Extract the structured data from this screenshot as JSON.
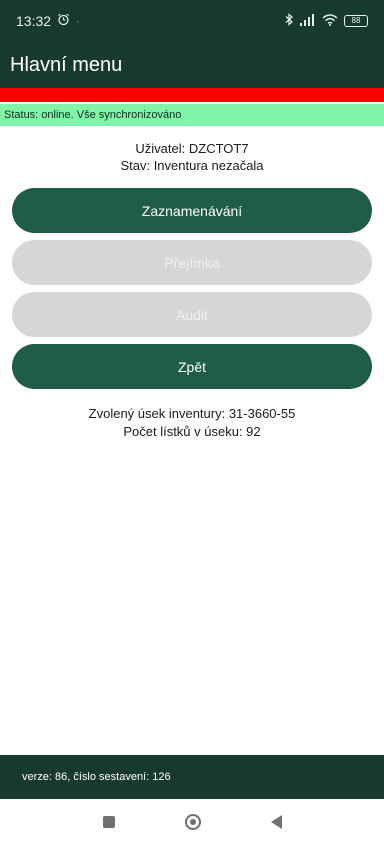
{
  "status_bar": {
    "time": "13:32",
    "alarm_icon": "alarm-clock-icon",
    "notification_dot": "·",
    "battery": "88"
  },
  "app_bar": {
    "title": "Hlavní menu"
  },
  "sync_status": "Status: online. Vše synchronizováno",
  "user_info": {
    "user": "Uživatel: DZCTOT7",
    "state": "Stav: Inventura nezačala"
  },
  "buttons": {
    "record": "Zaznamenávání",
    "receipt": "Přejímka",
    "audit": "Audit",
    "back": "Zpět"
  },
  "section": {
    "selected": "Zvolený úsek inventury: 31-3660-55",
    "count": "Počet lístků v úseku: 92"
  },
  "footer": {
    "version": "verze: 86, číslo sestavení: 126"
  },
  "colors": {
    "dark_green": "#173a2c",
    "button_green": "#1f5c4a",
    "alert_red": "#ff0000",
    "status_green": "#80f5a8",
    "disabled_gray": "#d6d6d6"
  }
}
